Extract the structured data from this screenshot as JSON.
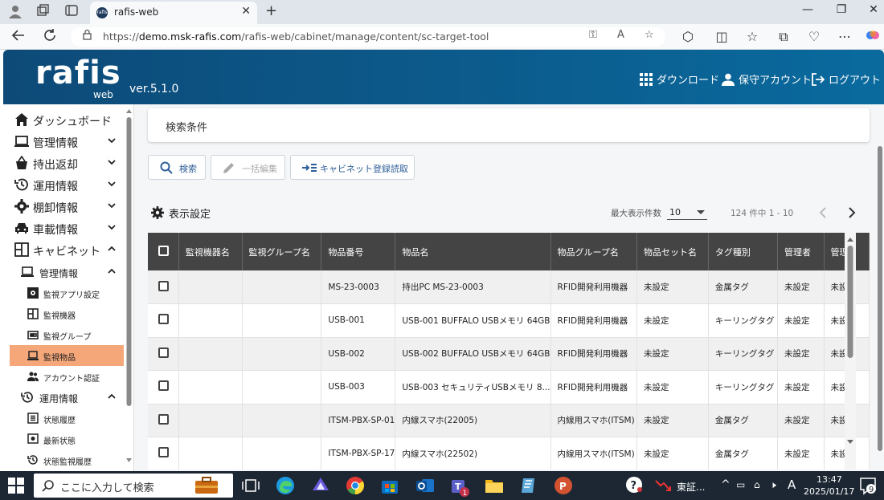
{
  "browser": {
    "tab_title": "rafis-web",
    "tab_favicon": "rafis",
    "url_prefix": "https://",
    "url_host": "demo.msk-rafis.com",
    "url_path": "/rafis-web/cabinet/manage/content/sc-target-tool"
  },
  "header": {
    "logo": "rafis",
    "logo_sub": "web",
    "version": "ver.5.1.0",
    "links": {
      "download": "ダウンロード",
      "maintenance": "保守アカウント",
      "logout": "ログアウト"
    }
  },
  "sidebar": {
    "items": [
      {
        "label": "ダッシュボード"
      },
      {
        "label": "管理情報"
      },
      {
        "label": "持出返却"
      },
      {
        "label": "運用情報"
      },
      {
        "label": "棚卸情報"
      },
      {
        "label": "車載情報"
      },
      {
        "label": "キャビネット"
      }
    ],
    "cabinet_sub": {
      "manage": "管理情報",
      "manage_items": [
        "監視アプリ設定",
        "監視機器",
        "監視グループ",
        "監視物品",
        "アカウント認証"
      ],
      "ops": "運用情報",
      "ops_items": [
        "状態履歴",
        "最新状態",
        "状態監視履歴"
      ]
    },
    "active": "監視物品"
  },
  "search": {
    "title": "検索条件",
    "search_btn": "検索",
    "bulk_edit_btn": "一括編集",
    "import_btn": "キャビネット登録読取"
  },
  "display_settings": "表示設定",
  "pagination": {
    "max_label": "最大表示件数",
    "per_page": "10",
    "count": "124 件中 1 - 10"
  },
  "table": {
    "headers": [
      "監視機器名",
      "監視グループ名",
      "物品番号",
      "物品名",
      "物品グループ名",
      "物品セット名",
      "タグ種別",
      "管理者",
      "管理"
    ],
    "rows": [
      {
        "c1": "",
        "c2": "",
        "no": "MS-23-0003",
        "name": "持出PC MS-23-0003",
        "group": "RFID開発利用機器",
        "set": "未設定",
        "tag": "金属タグ",
        "admin": "未設定",
        "mgmt": "未設定"
      },
      {
        "c1": "",
        "c2": "",
        "no": "USB-001",
        "name": "USB-001 BUFFALO USBメモリ 64GB",
        "group": "RFID開発利用機器",
        "set": "未設定",
        "tag": "キーリングタグ",
        "admin": "未設定",
        "mgmt": "未設定"
      },
      {
        "c1": "",
        "c2": "",
        "no": "USB-002",
        "name": "USB-002 BUFFALO USBメモリ 64GB",
        "group": "RFID開発利用機器",
        "set": "未設定",
        "tag": "キーリングタグ",
        "admin": "未設定",
        "mgmt": "未設定"
      },
      {
        "c1": "",
        "c2": "",
        "no": "USB-003",
        "name": "USB-003 セキュリティUSBメモリ 8...",
        "group": "RFID開発利用機器",
        "set": "未設定",
        "tag": "キーリングタグ",
        "admin": "未設定",
        "mgmt": "未設定"
      },
      {
        "c1": "",
        "c2": "",
        "no": "ITSM-PBX-SP-01",
        "name": "内線スマホ(22005)",
        "group": "内線用スマホ(ITSM)",
        "set": "未設定",
        "tag": "金属タグ",
        "admin": "未設定",
        "mgmt": "未設定"
      },
      {
        "c1": "",
        "c2": "",
        "no": "ITSM-PBX-SP-17",
        "name": "内線スマホ(22502)",
        "group": "内線用スマホ(ITSM)",
        "set": "未設定",
        "tag": "金属タグ",
        "admin": "未設定",
        "mgmt": "未設定"
      }
    ]
  },
  "taskbar": {
    "search_placeholder": "ここに入力して検索",
    "stock": "東証...",
    "ime": "A",
    "time": "13:47",
    "date": "2025/01/17",
    "teams_badge": "1",
    "notif_count": "9"
  },
  "colors": {
    "header_start": "#0d4a78",
    "header_end": "#0a6a9e",
    "active_item": "#f6a77a",
    "table_header": "#444444",
    "link_blue": "#2f5f99"
  }
}
